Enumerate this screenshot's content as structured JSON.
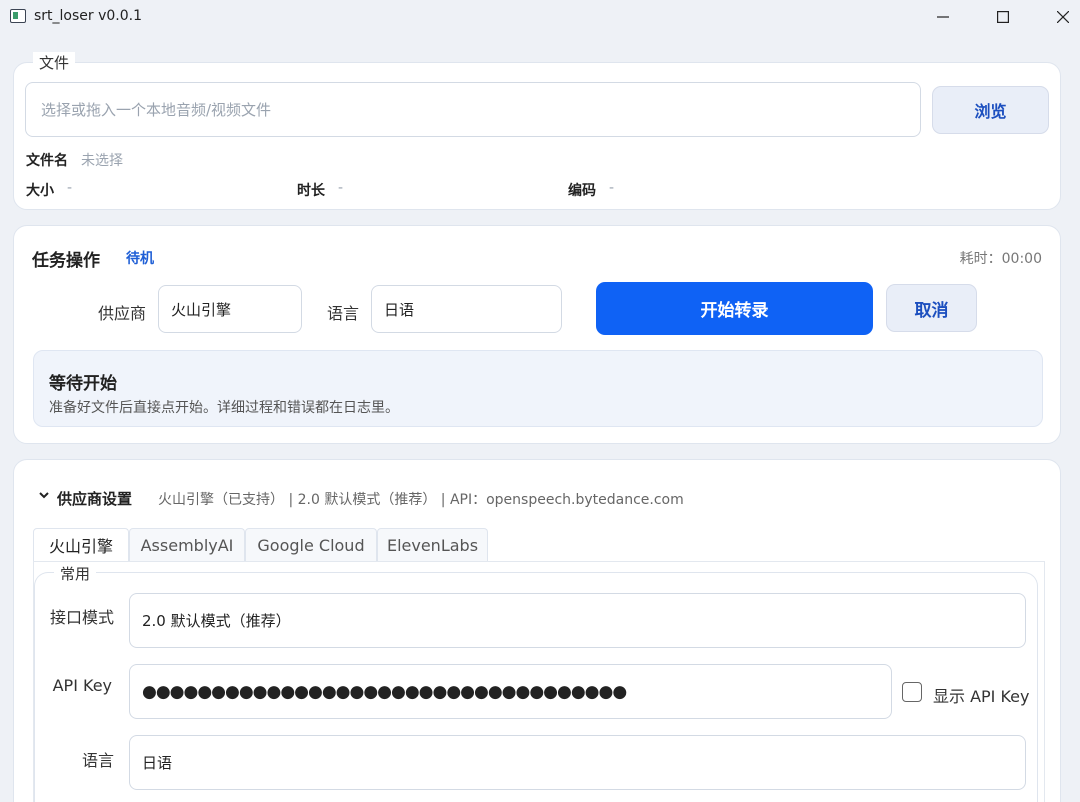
{
  "window": {
    "title": "srt_loser v0.0.1"
  },
  "file_section": {
    "legend": "文件",
    "input_placeholder": "选择或拖入一个本地音频/视频文件",
    "browse_label": "浏览",
    "filename_label": "文件名",
    "filename_value": "未选择",
    "size_label": "大小",
    "size_value": "-",
    "duration_label": "时长",
    "duration_value": "-",
    "codec_label": "编码",
    "codec_value": "-"
  },
  "task": {
    "title": "任务操作",
    "status": "待机",
    "elapsed": "耗时：00:00",
    "provider_label": "供应商",
    "provider_value": "火山引擎",
    "language_label": "语言",
    "language_value": "日语",
    "start_label": "开始转录",
    "cancel_label": "取消",
    "status_title": "等待开始",
    "status_desc": "准备好文件后直接点开始。详细过程和错误都在日志里。"
  },
  "provider_settings": {
    "title": "供应商设置",
    "summary": "火山引擎（已支持） | 2.0 默认模式（推荐） | API：openspeech.bytedance.com",
    "tabs": [
      "火山引擎",
      "AssemblyAI",
      "Google Cloud",
      "ElevenLabs"
    ],
    "active_tab": 0,
    "group_legend": "常用",
    "mode_label": "接口模式",
    "mode_value": "2.0 默认模式（推荐）",
    "apikey_label": "API Key",
    "apikey_value": "●●●●●●●●●●●●●●●●●●●●●●●●●●●●●●●●●●●",
    "show_apikey_label": "显示 API Key",
    "show_apikey_checked": false,
    "language_label": "语言",
    "language_value": "日语"
  },
  "colors": {
    "accent": "#0f62f5",
    "status_blue": "#1f5fd6",
    "background": "#eef1f6"
  }
}
